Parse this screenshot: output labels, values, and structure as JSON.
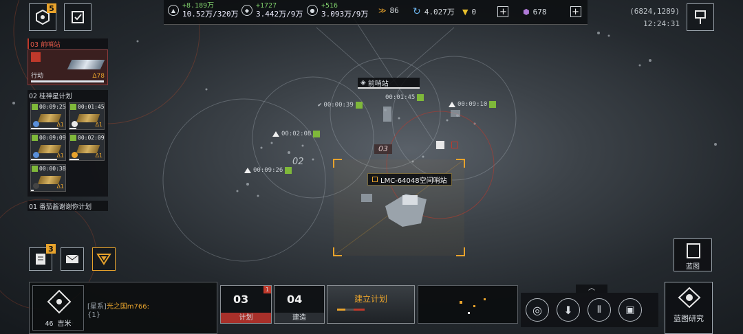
{
  "top_left": {
    "badge_count": "5"
  },
  "resources": [
    {
      "icon": "triangle-icon",
      "delta": "+8.189万",
      "amount": "10.52万/320万"
    },
    {
      "icon": "crystal-icon",
      "delta": "+1727",
      "amount": "3.442万/9万"
    },
    {
      "icon": "gas-icon",
      "delta": "+516",
      "amount": "3.093万/9万"
    }
  ],
  "fleet_count": "86",
  "currencies": [
    {
      "icon": "cycle-icon",
      "value": "4.027万"
    },
    {
      "icon": "gold-icon",
      "value": "0"
    },
    {
      "icon": "purple-icon",
      "value": "678"
    }
  ],
  "coords": "(6824,1289)",
  "clock": "12:24:31",
  "left_panel": {
    "section1": {
      "title": "03 前哨站",
      "action_label": "行动",
      "level": "Δ78"
    },
    "section2": {
      "title": "02 桂神星计划",
      "slots": [
        {
          "time": "00:09:25",
          "level": "Δ1"
        },
        {
          "time": "00:01:45",
          "level": "Δ1"
        },
        {
          "time": "00:09:09",
          "level": "Δ1"
        },
        {
          "time": "00:02:09",
          "level": "Δ1"
        },
        {
          "time": "00:00:38",
          "level": "Δ1"
        }
      ]
    },
    "section3": {
      "title": "01 番茄酱谢谢你计划"
    }
  },
  "map": {
    "outpost_label": "前哨站",
    "timers": [
      "00:00:39",
      "00:01:45",
      "00:09:10",
      "00:02:08",
      "00:09:26"
    ],
    "zone_02": "02",
    "zone_03": "03",
    "station_name": "LMC-64048空间哨站"
  },
  "left_buttons": {
    "task_badge": "3"
  },
  "blueprint_label": "蓝图",
  "bottom": {
    "distance": "46 吉米",
    "chat_channel": "[星系]",
    "chat_user": "光之国m766:",
    "chat_text": "{1}",
    "plan_count": "03",
    "plan_label": "计划",
    "plan_alert": "1",
    "build_count": "04",
    "build_label": "建造",
    "establish_label": "建立计划",
    "research_label": "蓝图研究"
  }
}
